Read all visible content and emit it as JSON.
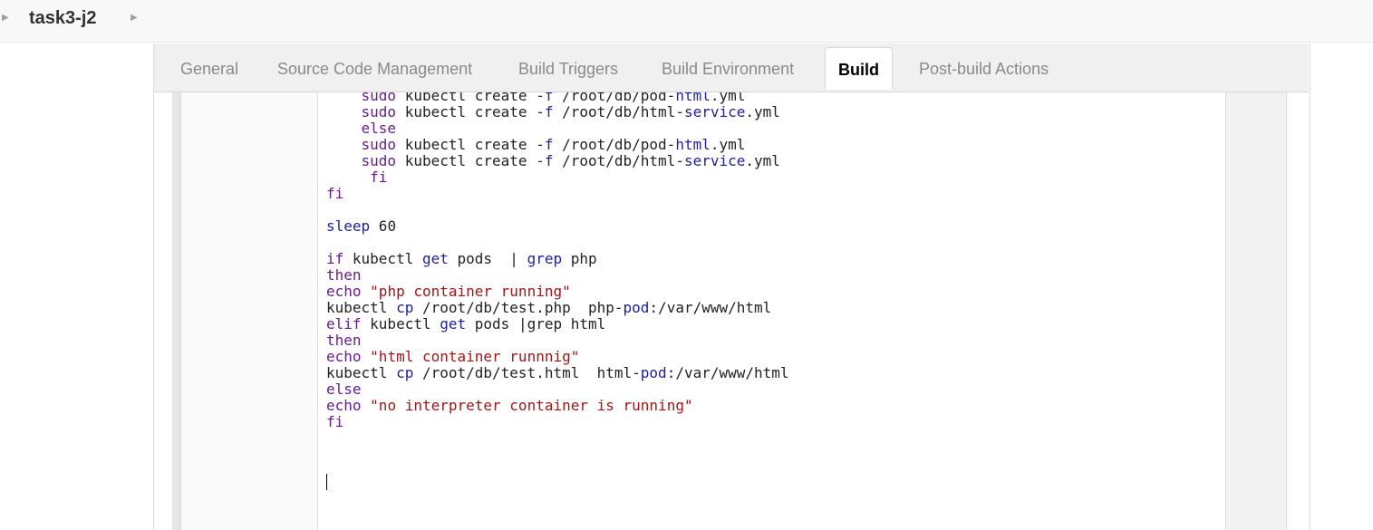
{
  "breadcrumb": {
    "title": "task3-j2"
  },
  "tabs": [
    {
      "label": "General",
      "active": false
    },
    {
      "label": "Source Code Management",
      "active": false
    },
    {
      "label": "Build Triggers",
      "active": false
    },
    {
      "label": "Build Environment",
      "active": false
    },
    {
      "label": "Build",
      "active": true
    },
    {
      "label": "Post-build Actions",
      "active": false
    }
  ],
  "editor": {
    "lines": [
      [
        {
          "t": "    "
        },
        {
          "t": "sudo",
          "c": "kw"
        },
        {
          "t": " kubectl create "
        },
        {
          "t": "-f",
          "c": "op"
        },
        {
          "t": " /root/db/pod-"
        },
        {
          "t": "html",
          "c": "cmd"
        },
        {
          "t": ".yml"
        }
      ],
      [
        {
          "t": "    "
        },
        {
          "t": "sudo",
          "c": "kw"
        },
        {
          "t": " kubectl create "
        },
        {
          "t": "-f",
          "c": "op"
        },
        {
          "t": " /root/db/html-"
        },
        {
          "t": "service",
          "c": "cmd"
        },
        {
          "t": ".yml"
        }
      ],
      [
        {
          "t": "    "
        },
        {
          "t": "else",
          "c": "kw"
        }
      ],
      [
        {
          "t": "    "
        },
        {
          "t": "sudo",
          "c": "kw"
        },
        {
          "t": " kubectl create "
        },
        {
          "t": "-f",
          "c": "op"
        },
        {
          "t": " /root/db/pod-"
        },
        {
          "t": "html",
          "c": "cmd"
        },
        {
          "t": ".yml"
        }
      ],
      [
        {
          "t": "    "
        },
        {
          "t": "sudo",
          "c": "kw"
        },
        {
          "t": " kubectl create "
        },
        {
          "t": "-f",
          "c": "op"
        },
        {
          "t": " /root/db/html-"
        },
        {
          "t": "service",
          "c": "cmd"
        },
        {
          "t": ".yml"
        }
      ],
      [
        {
          "t": "     "
        },
        {
          "t": "fi",
          "c": "kw"
        }
      ],
      [
        {
          "t": "fi",
          "c": "kw"
        }
      ],
      [
        {
          "t": ""
        }
      ],
      [
        {
          "t": "sleep",
          "c": "cmd"
        },
        {
          "t": " 60"
        }
      ],
      [
        {
          "t": ""
        }
      ],
      [
        {
          "t": "if",
          "c": "kw"
        },
        {
          "t": " kubectl "
        },
        {
          "t": "get",
          "c": "cmd"
        },
        {
          "t": " pods  | "
        },
        {
          "t": "grep",
          "c": "cmd"
        },
        {
          "t": " php"
        }
      ],
      [
        {
          "t": "then",
          "c": "kw"
        }
      ],
      [
        {
          "t": "echo",
          "c": "kw"
        },
        {
          "t": " "
        },
        {
          "t": "\"php container running\"",
          "c": "str"
        }
      ],
      [
        {
          "t": "kubectl "
        },
        {
          "t": "cp",
          "c": "cmd"
        },
        {
          "t": " /root/db/test.php  php-"
        },
        {
          "t": "pod",
          "c": "cmd"
        },
        {
          "t": ":/var/www/html"
        }
      ],
      [
        {
          "t": "elif",
          "c": "kw"
        },
        {
          "t": " kubectl "
        },
        {
          "t": "get",
          "c": "cmd"
        },
        {
          "t": " pods |grep html"
        }
      ],
      [
        {
          "t": "then",
          "c": "kw"
        }
      ],
      [
        {
          "t": "echo",
          "c": "kw"
        },
        {
          "t": " "
        },
        {
          "t": "\"html container runnnig\"",
          "c": "str"
        }
      ],
      [
        {
          "t": "kubectl "
        },
        {
          "t": "cp",
          "c": "cmd"
        },
        {
          "t": " /root/db/test.html  html-"
        },
        {
          "t": "pod",
          "c": "cmd"
        },
        {
          "t": ":/var/www/html"
        }
      ],
      [
        {
          "t": "else",
          "c": "kw"
        }
      ],
      [
        {
          "t": "echo",
          "c": "kw"
        },
        {
          "t": " "
        },
        {
          "t": "\"no interpreter container is running\"",
          "c": "str"
        }
      ],
      [
        {
          "t": "fi",
          "c": "kw"
        }
      ]
    ]
  }
}
